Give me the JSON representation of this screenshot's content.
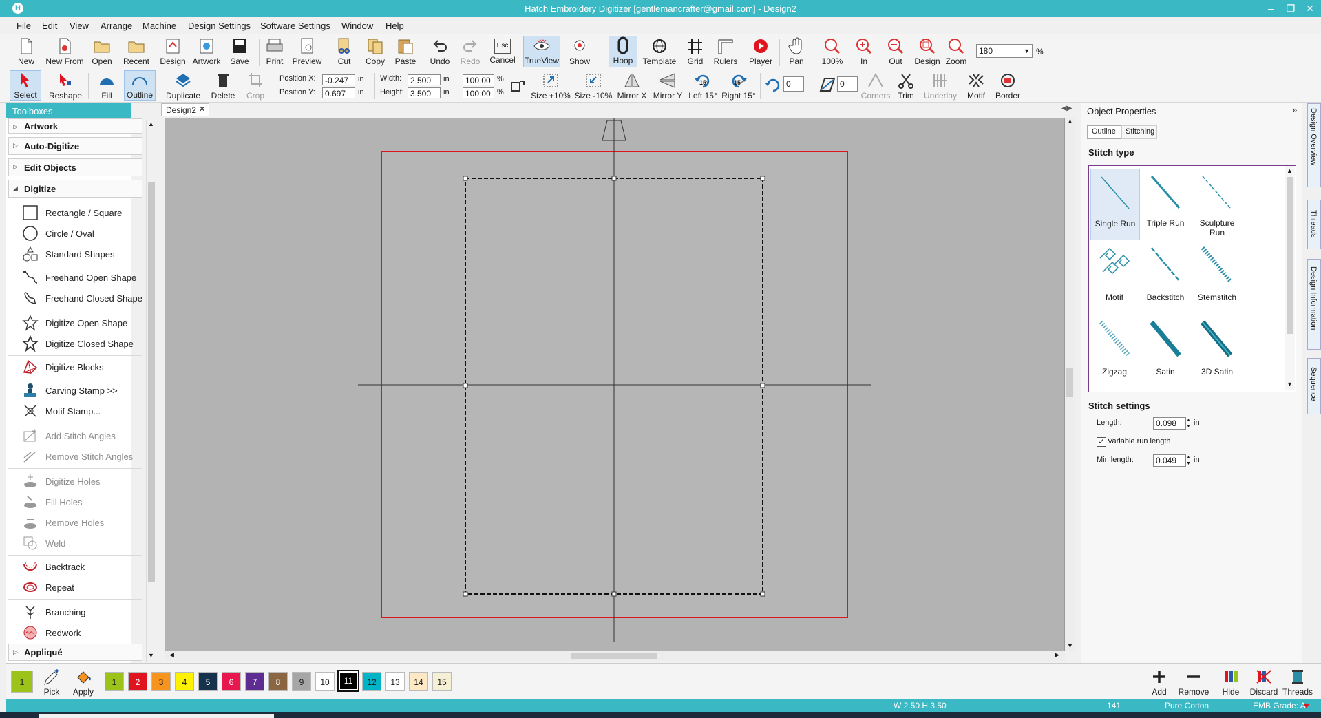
{
  "titlebar": {
    "title": "Hatch Embroidery Digitizer [gentlemancrafter@gmail.com] - Design2",
    "icon": "H"
  },
  "menu": [
    "File",
    "Edit",
    "View",
    "Arrange",
    "Machine",
    "Design Settings",
    "Software Settings",
    "Window",
    "Help"
  ],
  "toolbar1": {
    "items": [
      "New",
      "New From",
      "Open",
      "Recent",
      "Design",
      "Artwork",
      "Save",
      "Print",
      "Preview",
      "Cut",
      "Copy",
      "Paste",
      "Undo",
      "Redo",
      "Cancel",
      "TrueView",
      "Show",
      "Hoop",
      "Template",
      "Grid",
      "Rulers",
      "Player",
      "Pan",
      "100%",
      "In",
      "Out",
      "Design",
      "Zoom"
    ],
    "cancel_key": "Esc",
    "zoom_value": "180",
    "zoom_unit": "%"
  },
  "toolbar2": {
    "items": [
      "Select",
      "Reshape",
      "Fill",
      "Outline",
      "Duplicate",
      "Delete",
      "Crop"
    ],
    "position_x_label": "Position X:",
    "position_x": "-0.247",
    "position_y_label": "Position Y:",
    "position_y": "0.697",
    "width_label": "Width:",
    "width": "2.500",
    "height_label": "Height:",
    "height": "3.500",
    "unit": "in",
    "scale_w": "100.00",
    "scale_h": "100.00",
    "pct": "%",
    "tools": [
      "Size +10%",
      "Size -10%",
      "Mirror X",
      "Mirror Y",
      "Left 15°",
      "Right 15°"
    ],
    "angle_badge": "15°",
    "rotate_value": "0",
    "slant_value": "0",
    "right_tools": [
      "Corners",
      "Trim",
      "Underlay",
      "Motif",
      "Border"
    ]
  },
  "toolboxes": {
    "header": "Toolboxes",
    "groups": [
      "Artwork",
      "Auto-Digitize",
      "Edit Objects",
      "Digitize"
    ],
    "items": [
      "Rectangle / Square",
      "Circle / Oval",
      "Standard Shapes",
      "Freehand Open Shape",
      "Freehand Closed Shape",
      "Digitize Open Shape",
      "Digitize Closed Shape",
      "Digitize Blocks",
      "Carving Stamp >>",
      "Motif Stamp...",
      "Add Stitch Angles",
      "Remove Stitch Angles",
      "Digitize Holes",
      "Fill Holes",
      "Remove Holes",
      "Weld",
      "Backtrack",
      "Repeat",
      "Branching",
      "Redwork"
    ],
    "last_group": "Appliqué"
  },
  "document": {
    "tab": "Design2"
  },
  "properties": {
    "title": "Object Properties",
    "tabs": [
      "Outline",
      "Stitching"
    ],
    "stitch_type_label": "Stitch type",
    "stitch_types": [
      "Single Run",
      "Triple Run",
      "Sculpture Run",
      "Motif",
      "Backstitch",
      "Stemstitch",
      "Zigzag",
      "Satin",
      "3D Satin"
    ],
    "settings_label": "Stitch settings",
    "length_label": "Length:",
    "length": "0.098",
    "variable_label": "Variable run length",
    "min_label": "Min length:",
    "min_length": "0.049",
    "unit": "in"
  },
  "side_tabs": [
    "Design Overview",
    "Threads",
    "Design Information",
    "Sequence"
  ],
  "palette": {
    "current": "1",
    "pick": "Pick",
    "apply": "Apply",
    "swatches": [
      {
        "n": "1",
        "c": "#9cc31a"
      },
      {
        "n": "2",
        "c": "#e0141e"
      },
      {
        "n": "3",
        "c": "#f7941d"
      },
      {
        "n": "4",
        "c": "#fff200"
      },
      {
        "n": "5",
        "c": "#17324d"
      },
      {
        "n": "6",
        "c": "#e8174d"
      },
      {
        "n": "7",
        "c": "#5d2d91"
      },
      {
        "n": "8",
        "c": "#8a6642"
      },
      {
        "n": "9",
        "c": "#a6a6a6"
      },
      {
        "n": "10",
        "c": "#ffffff"
      },
      {
        "n": "11",
        "c": "#000000"
      },
      {
        "n": "12",
        "c": "#00b3c7"
      },
      {
        "n": "13",
        "c": "#ffffff"
      },
      {
        "n": "14",
        "c": "#fde9c4"
      },
      {
        "n": "15",
        "c": "#f5efd6"
      }
    ],
    "right_buttons": [
      "Add",
      "Remove",
      "Hide",
      "Discard",
      "Threads"
    ]
  },
  "status": {
    "size": "W 2.50 H 3.50",
    "count": "141",
    "thread": "Pure Cotton",
    "grade": "EMB Grade: A"
  }
}
